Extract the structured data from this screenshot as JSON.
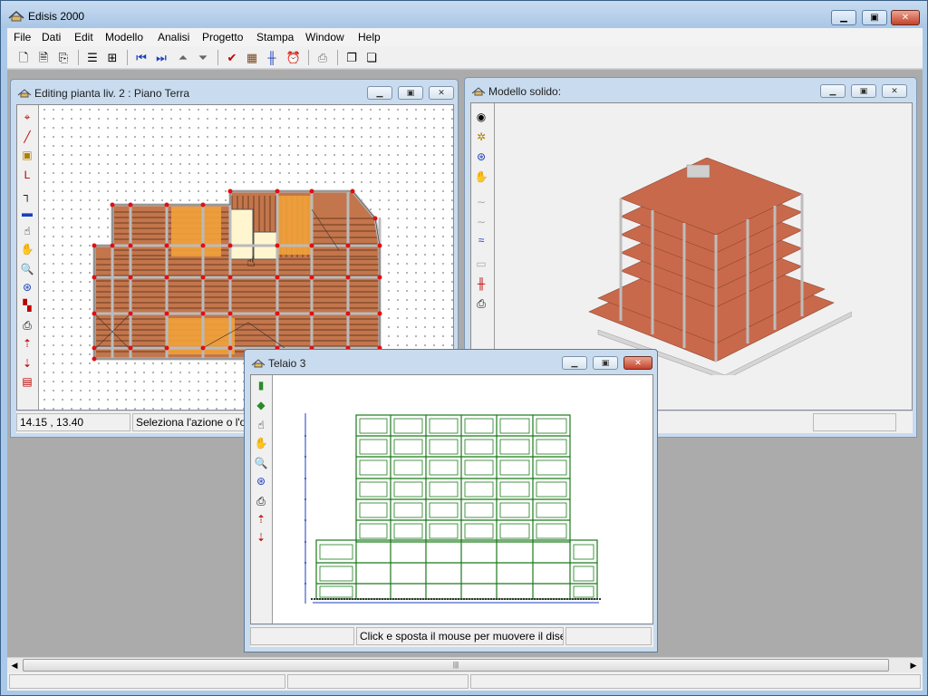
{
  "app": {
    "title": "Edisis 2000"
  },
  "menu": [
    "File",
    "Dati",
    "Edit",
    "Modello",
    "Analisi",
    "Progetto",
    "Stampa",
    "Window",
    "Help"
  ],
  "toolbar": {
    "icons": [
      "new-file-icon",
      "open-file-icon",
      "copy-file-icon",
      "align-left-icon",
      "align-grid-icon",
      "first-level-icon",
      "last-level-icon",
      "level-up-icon",
      "level-down-icon",
      "check-icon",
      "build-model-icon",
      "frames-icon",
      "clock-icon",
      "print-icon",
      "copy-icon",
      "paste-icon"
    ]
  },
  "windows": {
    "plan": {
      "title": "Editing pianta liv. 2 : Piano Terra",
      "coords": "14.15 , 13.40",
      "status": "Seleziona l'azione o l'og"
    },
    "solid": {
      "title": "Modello solido:"
    },
    "frame": {
      "title": "Telaio 3",
      "status": "Click e sposta il mouse per muovere il dise"
    }
  },
  "colors": {
    "mdi_background": "#ababab",
    "slab": "#c66a4e",
    "beam": "#d9d9d9",
    "frame_line": "#1a7a1a",
    "node": "#e01010"
  }
}
